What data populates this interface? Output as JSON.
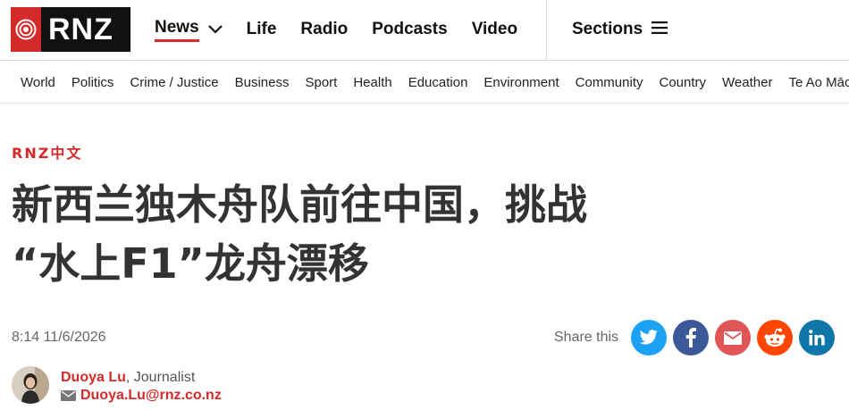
{
  "brand": {
    "logo_text": "RNZ",
    "accent_color": "#d42a2a"
  },
  "main_nav": {
    "items": [
      {
        "label": "News",
        "active": true,
        "has_dropdown": true
      },
      {
        "label": "Life"
      },
      {
        "label": "Radio"
      },
      {
        "label": "Podcasts"
      },
      {
        "label": "Video"
      }
    ],
    "sections_label": "Sections"
  },
  "sub_nav": {
    "items": [
      "World",
      "Politics",
      "Crime / Justice",
      "Business",
      "Sport",
      "Health",
      "Education",
      "Environment",
      "Community",
      "Country",
      "Weather",
      "Te Ao Māori"
    ]
  },
  "article": {
    "kicker": "RNZ中文",
    "headline_line1": "新西兰独木舟队前往中国，挑战",
    "headline_line2": "“水上F1”龙舟漂移",
    "timestamp": "8:14 11/6/2026",
    "share_label": "Share this",
    "share_icons": [
      "twitter-icon",
      "facebook-icon",
      "email-icon",
      "reddit-icon",
      "linkedin-icon"
    ],
    "author_name": "Duoya Lu",
    "author_role": ", Journalist",
    "author_email": "Duoya.Lu@rnz.co.nz"
  }
}
